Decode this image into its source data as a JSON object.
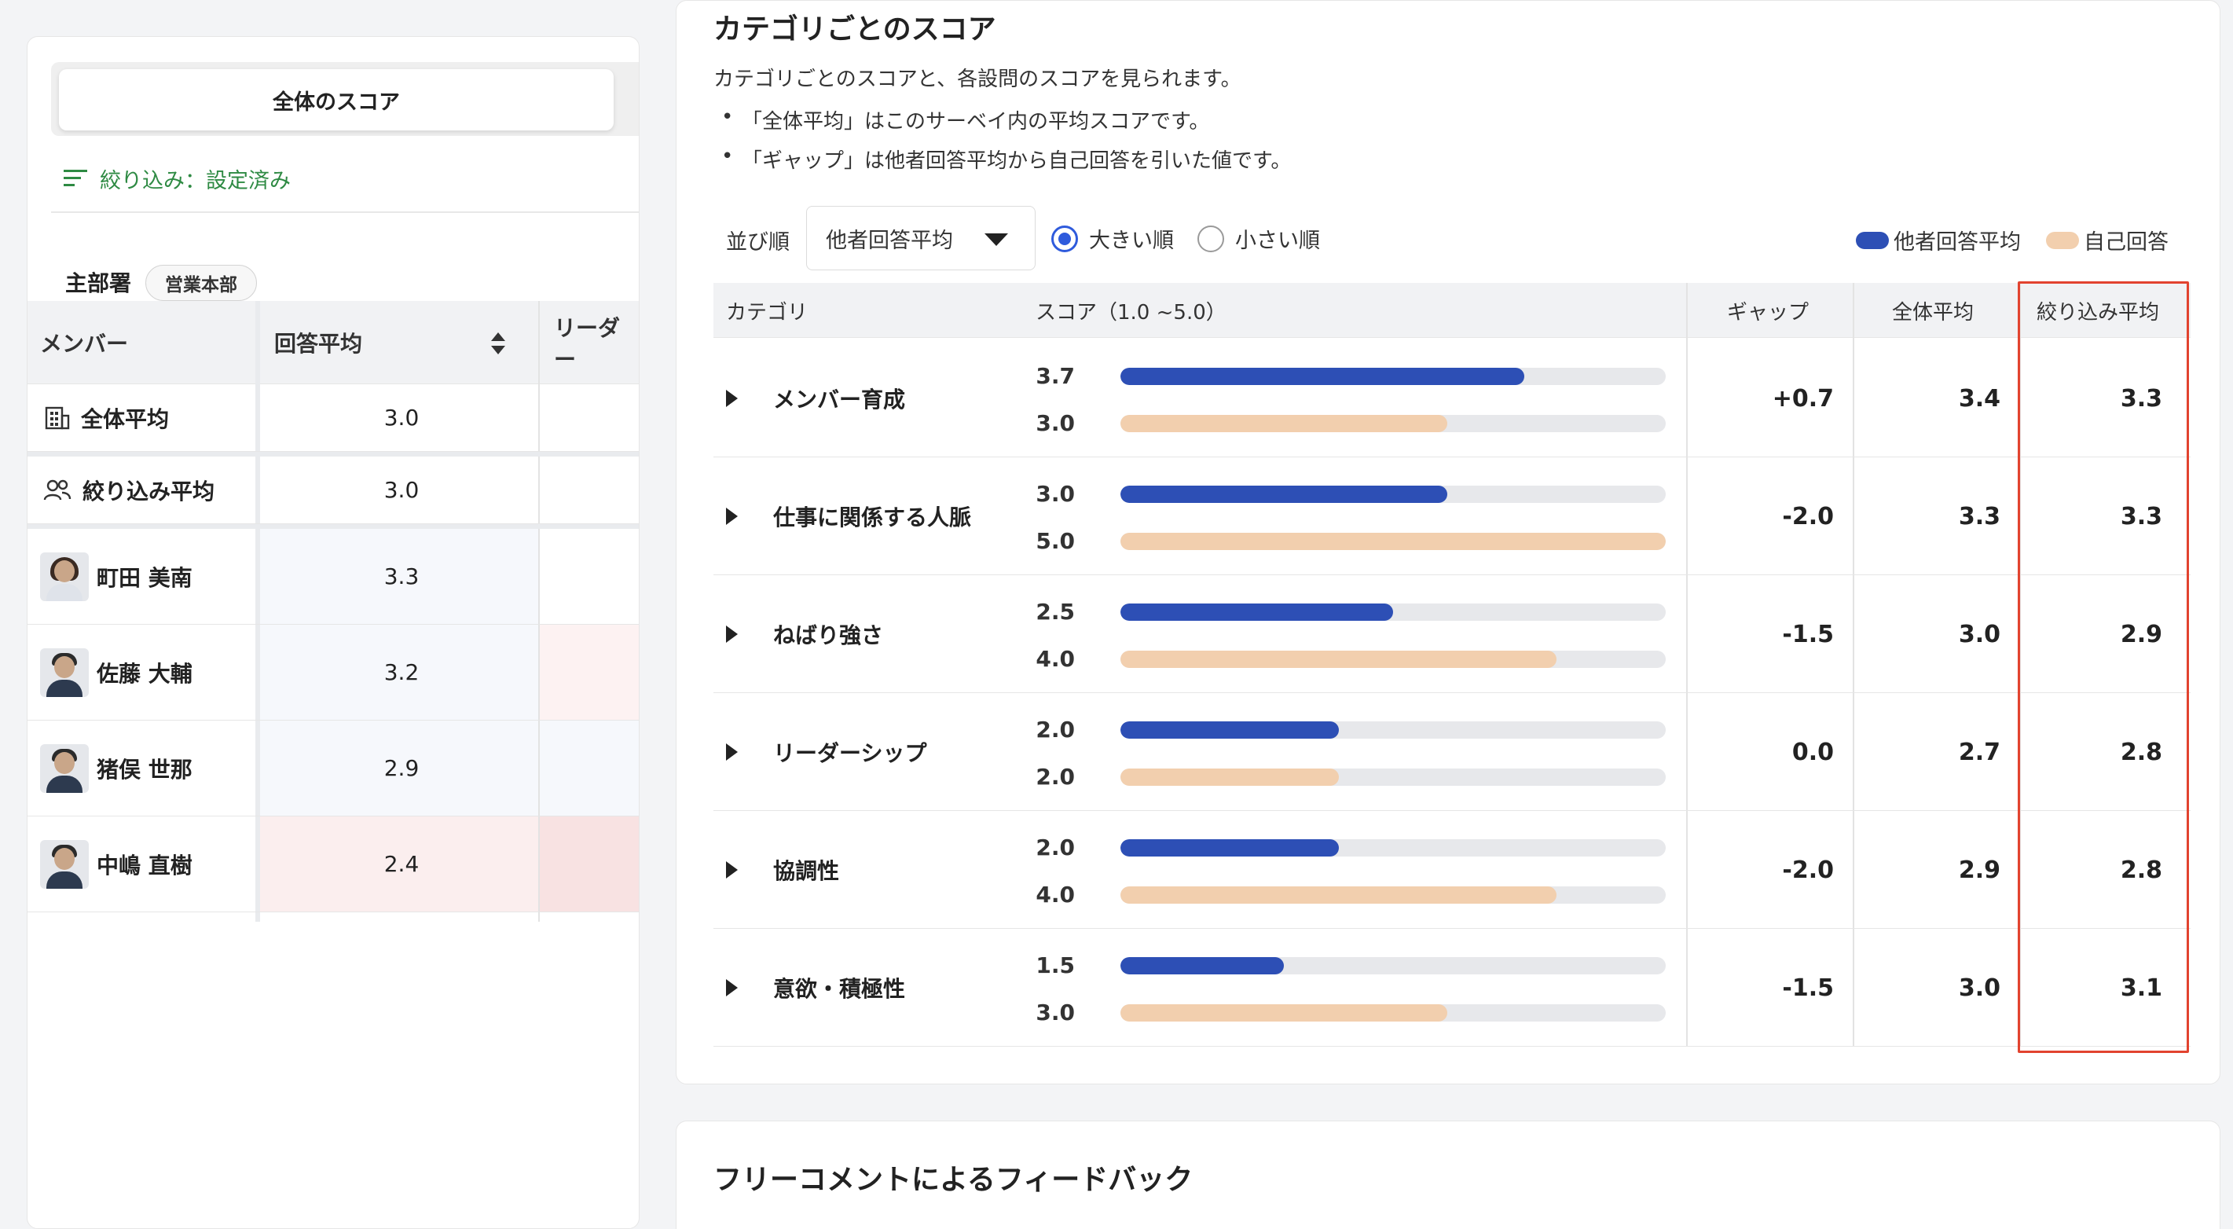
{
  "left": {
    "tab_active": "全体のスコア",
    "filter_label": "絞り込み：設定済み",
    "dept_label": "主部署",
    "dept_badge": "営業本部",
    "columns": [
      "メンバー",
      "回答平均",
      "リーダー"
    ],
    "summary_rows": [
      {
        "name": "全体平均",
        "value": "3.0",
        "icon": "building-icon"
      },
      {
        "name": "絞り込み平均",
        "value": "3.0",
        "icon": "people-icon"
      }
    ],
    "members": [
      {
        "name": "町田 美南",
        "value": "3.3"
      },
      {
        "name": "佐藤 大輔",
        "value": "3.2"
      },
      {
        "name": "猪俣 世那",
        "value": "2.9"
      },
      {
        "name": "中嶋 直樹",
        "value": "2.4"
      }
    ]
  },
  "category": {
    "title": "カテゴリごとのスコア",
    "desc": "カテゴリごとのスコアと、各設問のスコアを見られます。",
    "bullets": [
      "「全体平均」はこのサーベイ内の平均スコアです。",
      "「ギャップ」は他者回答平均から自己回答を引いた値です。"
    ],
    "sort_label": "並び順",
    "sort_select": "他者回答平均",
    "radio_desc": "大きい順",
    "radio_asc": "小さい順",
    "legend_others": "他者回答平均",
    "legend_self": "自己回答",
    "colors": {
      "others": "#2d4fb5",
      "self": "#f2cfae",
      "highlight": "#e2432f"
    },
    "columns": {
      "category": "カテゴリ",
      "score": "スコア（1.0 ~5.0）",
      "gap": "ギャップ",
      "overall": "全体平均",
      "filtered": "絞り込み平均"
    },
    "rows": [
      {
        "name": "メンバー育成",
        "others": "3.7",
        "self": "3.0",
        "gap": "+0.7",
        "overall": "3.4",
        "filtered": "3.3"
      },
      {
        "name": "仕事に関係する人脈",
        "others": "3.0",
        "self": "5.0",
        "gap": "-2.0",
        "overall": "3.3",
        "filtered": "3.3"
      },
      {
        "name": "ねばり強さ",
        "others": "2.5",
        "self": "4.0",
        "gap": "-1.5",
        "overall": "3.0",
        "filtered": "2.9"
      },
      {
        "name": "リーダーシップ",
        "others": "2.0",
        "self": "2.0",
        "gap": "0.0",
        "overall": "2.7",
        "filtered": "2.8"
      },
      {
        "name": "協調性",
        "others": "2.0",
        "self": "4.0",
        "gap": "-2.0",
        "overall": "2.9",
        "filtered": "2.8"
      },
      {
        "name": "意欲・積極性",
        "others": "1.5",
        "self": "3.0",
        "gap": "-1.5",
        "overall": "3.0",
        "filtered": "3.1"
      }
    ]
  },
  "feedback": {
    "title": "フリーコメントによるフィードバック"
  }
}
